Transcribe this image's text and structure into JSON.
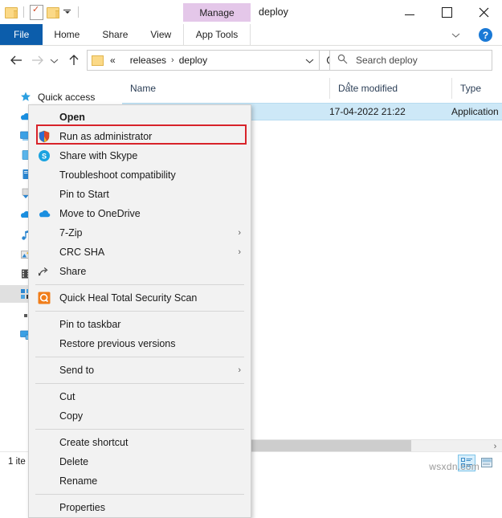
{
  "window": {
    "title": "deploy",
    "contextual_tab_group": "Manage",
    "minimize_label": "Minimize",
    "maximize_label": "Maximize",
    "close_label": "Close",
    "help_label": "?"
  },
  "quick_access_toolbar": {
    "items": [
      {
        "name": "explorer-icon",
        "label": "File Explorer"
      },
      {
        "name": "properties-icon",
        "label": "Properties"
      },
      {
        "name": "new-folder-icon",
        "label": "New folder"
      },
      {
        "name": "customize-caret-icon",
        "label": "Customize Quick Access Toolbar"
      }
    ]
  },
  "ribbon": {
    "tabs": [
      {
        "label": "File",
        "active": true
      },
      {
        "label": "Home",
        "active": false
      },
      {
        "label": "Share",
        "active": false
      },
      {
        "label": "View",
        "active": false
      }
    ],
    "contextual_tab": "App Tools"
  },
  "navigation": {
    "back_label": "Back",
    "forward_label": "Forward",
    "recent_label": "Recent locations",
    "up_label": "Up",
    "breadcrumb": {
      "overflow": "«",
      "parts": [
        "releases",
        "deploy"
      ],
      "separator": "›"
    },
    "dropdown_label": "Previous locations",
    "refresh_label": "Refresh"
  },
  "search": {
    "placeholder": "Search deploy",
    "icon": "search-icon"
  },
  "columns": [
    {
      "key": "name",
      "label": "Name",
      "sorted": true,
      "sort_glyph": "˄"
    },
    {
      "key": "date",
      "label": "Date modified",
      "sorted": false
    },
    {
      "key": "type",
      "label": "Type",
      "sorted": false
    }
  ],
  "files": [
    {
      "name": "",
      "date": "17-04-2022 21:22",
      "type": "Application",
      "selected": true
    }
  ],
  "nav_pane": {
    "items": [
      {
        "label": "Quick access",
        "icon": "star-pin-icon",
        "selected": false
      },
      {
        "label": "",
        "icon": "onedrive-icon",
        "selected": false
      },
      {
        "label": "",
        "icon": "this-pc-icon",
        "selected": false
      },
      {
        "label": "",
        "icon": "folder-blue-icon",
        "selected": false
      },
      {
        "label": "",
        "icon": "documents-icon",
        "selected": false
      },
      {
        "label": "",
        "icon": "downloads-icon",
        "selected": false
      },
      {
        "label": "",
        "icon": "onedrive-cloud-icon",
        "selected": false
      },
      {
        "label": "",
        "icon": "music-icon",
        "selected": false
      },
      {
        "label": "",
        "icon": "pictures-icon",
        "selected": false
      },
      {
        "label": "",
        "icon": "videos-icon",
        "selected": false
      },
      {
        "label": "",
        "icon": "network-icon",
        "selected": true
      },
      {
        "label": "",
        "icon": "disk-icon",
        "selected": false
      },
      {
        "label": "",
        "icon": "network-pc-icon",
        "selected": false
      }
    ]
  },
  "context_menu": {
    "groups": [
      {
        "items": [
          {
            "label": "Open",
            "icon": "",
            "bold": true,
            "submenu": false
          },
          {
            "label": "Run as administrator",
            "icon": "shield-icon",
            "bold": false,
            "submenu": false,
            "highlighted": true
          },
          {
            "label": "Share with Skype",
            "icon": "skype-icon",
            "bold": false,
            "submenu": false
          },
          {
            "label": "Troubleshoot compatibility",
            "icon": "",
            "bold": false,
            "submenu": false
          },
          {
            "label": "Pin to Start",
            "icon": "",
            "bold": false,
            "submenu": false
          },
          {
            "label": "Move to OneDrive",
            "icon": "onedrive-icon",
            "bold": false,
            "submenu": false
          },
          {
            "label": "7-Zip",
            "icon": "",
            "bold": false,
            "submenu": true
          },
          {
            "label": "CRC SHA",
            "icon": "",
            "bold": false,
            "submenu": true
          },
          {
            "label": "Share",
            "icon": "share-icon",
            "bold": false,
            "submenu": false
          }
        ]
      },
      {
        "items": [
          {
            "label": "Quick Heal Total Security Scan",
            "icon": "quickheal-icon",
            "bold": false,
            "submenu": false
          }
        ]
      },
      {
        "items": [
          {
            "label": "Pin to taskbar",
            "icon": "",
            "bold": false,
            "submenu": false
          },
          {
            "label": "Restore previous versions",
            "icon": "",
            "bold": false,
            "submenu": false
          }
        ]
      },
      {
        "items": [
          {
            "label": "Send to",
            "icon": "",
            "bold": false,
            "submenu": true
          }
        ]
      },
      {
        "items": [
          {
            "label": "Cut",
            "icon": "",
            "bold": false,
            "submenu": false
          },
          {
            "label": "Copy",
            "icon": "",
            "bold": false,
            "submenu": false
          }
        ]
      },
      {
        "items": [
          {
            "label": "Create shortcut",
            "icon": "",
            "bold": false,
            "submenu": false
          },
          {
            "label": "Delete",
            "icon": "",
            "bold": false,
            "submenu": false
          },
          {
            "label": "Rename",
            "icon": "",
            "bold": false,
            "submenu": false
          }
        ]
      },
      {
        "items": [
          {
            "label": "Properties",
            "icon": "",
            "bold": false,
            "submenu": false
          }
        ]
      }
    ],
    "submenu_glyph": "›",
    "highlight_color": "#d8232a"
  },
  "status_bar": {
    "item_count_text": "1 ite",
    "view_buttons": [
      {
        "name": "details-view-button",
        "active": true
      },
      {
        "name": "large-icons-view-button",
        "active": false
      }
    ]
  },
  "scrollbar": {
    "right_arrow_glyph": "›"
  },
  "watermark": "wsxdn.com",
  "colors": {
    "file_tab": "#0c5dab",
    "manage_tab": "#e4c7e9",
    "selection": "#cde8f7",
    "highlight_red": "#d8232a",
    "help_blue": "#1a79d6"
  }
}
